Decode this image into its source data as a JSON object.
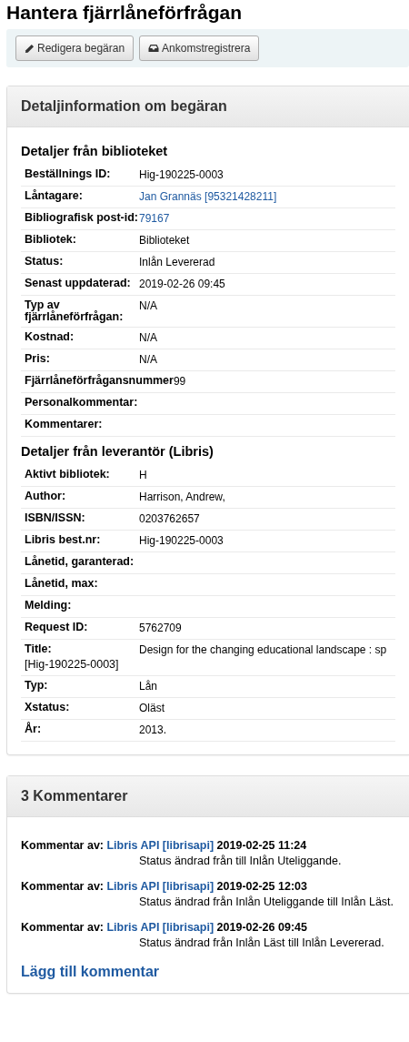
{
  "page_title": "Hantera fjärrlåneförfrågan",
  "toolbar": [
    {
      "kind": "pencil",
      "label": "Redigera begäran"
    },
    {
      "kind": "inbox",
      "label": "Ankomstregistrera"
    }
  ],
  "details_panel": {
    "title": "Detaljinformation om begäran",
    "sections": [
      {
        "heading": "Detaljer från biblioteket",
        "rows": [
          {
            "label": "Beställnings ID:",
            "value": "Hig-190225-0003",
            "link": false
          },
          {
            "label": "Låntagare:",
            "value": "Jan Grannäs [95321428211]",
            "link": true
          },
          {
            "label": "Bibliografisk post-id:",
            "value": "79167",
            "link": true
          },
          {
            "label": "Bibliotek:",
            "value": "Biblioteket",
            "link": false
          },
          {
            "label": "Status:",
            "value": "Inlån Levererad",
            "link": false
          },
          {
            "label": "Senast uppdaterad:",
            "value": "2019-02-26 09:45",
            "link": false
          },
          {
            "label": "Typ av fjärrlåneförfrågan:",
            "value": "N/A",
            "link": false
          },
          {
            "label": "Kostnad:",
            "value": "N/A",
            "link": false
          },
          {
            "label": "Pris:",
            "value": "N/A",
            "link": false
          },
          {
            "label": "Fjärrlåneförfrågansnummer",
            "value": "99",
            "link": false
          },
          {
            "label": "Personalkommentar:"
          },
          {
            "label": "Kommentarer:"
          }
        ]
      },
      {
        "heading": "Detaljer från leverantör (Libris)",
        "rows": [
          {
            "label": "Aktivt bibliotek:",
            "value": "H",
            "link": false
          },
          {
            "label": "Author:",
            "value": "Harrison, Andrew,",
            "link": false
          },
          {
            "label": "ISBN/ISSN:",
            "value": "0203762657",
            "link": false
          },
          {
            "label": "Libris best.nr:",
            "value": "Hig-190225-0003",
            "link": false
          },
          {
            "label": "Lånetid, garanterad:"
          },
          {
            "label": "Lånetid, max:"
          },
          {
            "label": "Melding:"
          },
          {
            "label": "Request ID:",
            "value": "5762709",
            "link": false
          },
          {
            "label": "Title:",
            "note": "[Hig-190225-0003]",
            "value": "Design for the changing educational landscape : sp",
            "link": false
          },
          {
            "label": "Typ:",
            "value": "Lån",
            "link": false
          },
          {
            "label": "Xstatus:",
            "value": "Oläst",
            "link": false
          },
          {
            "label": "År:",
            "value": "2013.",
            "link": false
          }
        ]
      }
    ]
  },
  "comments_panel": {
    "title": "3 Kommentarer",
    "comments": [
      {
        "prefix": "Kommentar av:",
        "author": "Libris API [librisapi]",
        "date": "2019-02-25 11:24",
        "text": "Status ändrad från till Inlån Uteliggande."
      },
      {
        "prefix": "Kommentar av:",
        "author": "Libris API [librisapi]",
        "date": "2019-02-25 12:03",
        "text": "Status ändrad från Inlån Uteliggande till Inlån Läst."
      },
      {
        "prefix": "Kommentar av:",
        "author": "Libris API [librisapi]",
        "date": "2019-02-26 09:45",
        "text": "Status ändrad från Inlån Läst till Inlån Levererad."
      }
    ],
    "add_link": "Lägg till kommentar"
  }
}
